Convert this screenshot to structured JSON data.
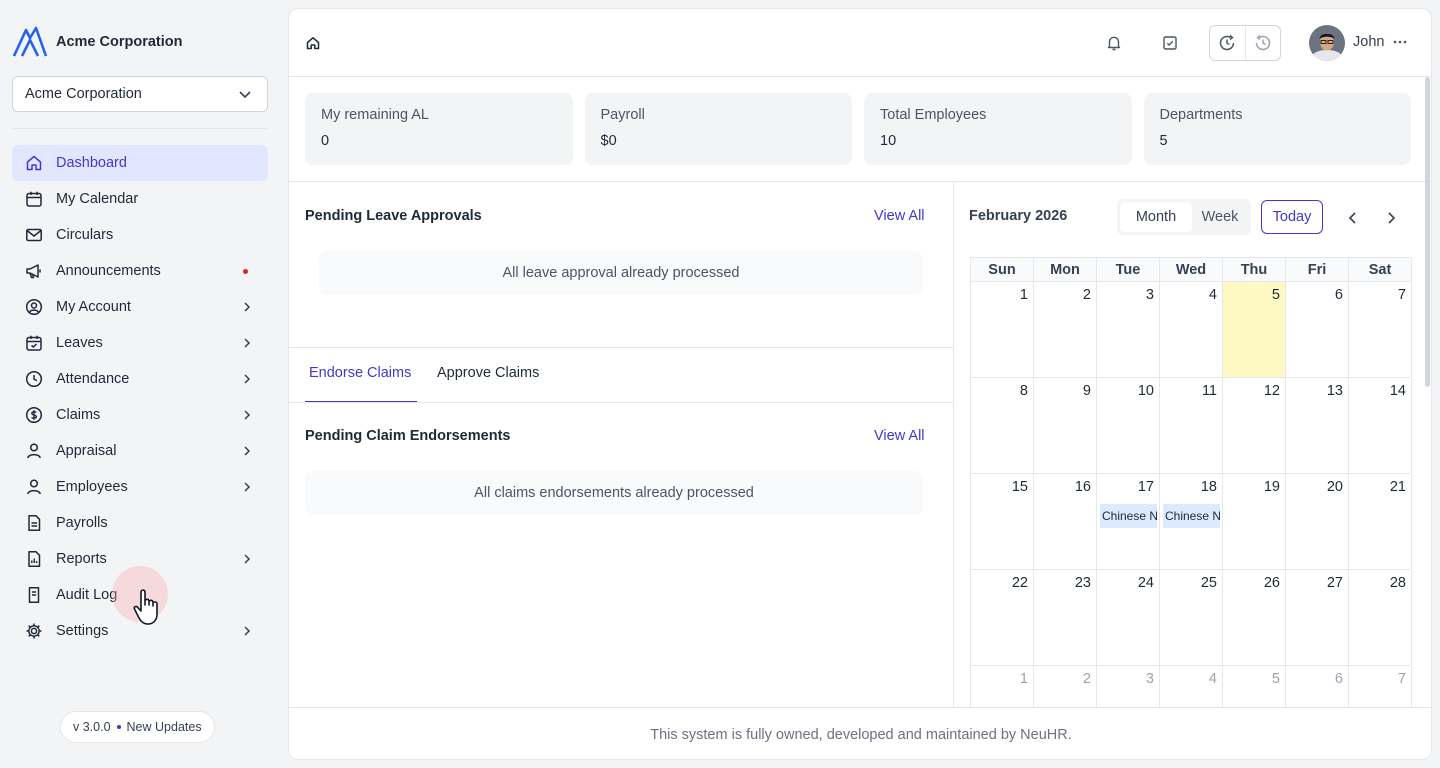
{
  "brand": {
    "name": "Acme Corporation"
  },
  "org_select": {
    "value": "Acme Corporation"
  },
  "sidebar": {
    "items": [
      {
        "label": "Dashboard",
        "icon": "home-icon"
      },
      {
        "label": "My Calendar",
        "icon": "calendar-icon"
      },
      {
        "label": "Circulars",
        "icon": "mail-icon"
      },
      {
        "label": "Announcements",
        "icon": "megaphone-icon"
      },
      {
        "label": "My Account",
        "icon": "user-circle-icon"
      },
      {
        "label": "Leaves",
        "icon": "calendar-check-icon"
      },
      {
        "label": "Attendance",
        "icon": "clock-icon"
      },
      {
        "label": "Claims",
        "icon": "dollar-icon"
      },
      {
        "label": "Appraisal",
        "icon": "user-icon"
      },
      {
        "label": "Employees",
        "icon": "user-icon"
      },
      {
        "label": "Payrolls",
        "icon": "document-icon"
      },
      {
        "label": "Reports",
        "icon": "report-icon"
      },
      {
        "label": "Audit Log",
        "icon": "receipt-icon"
      },
      {
        "label": "Settings",
        "icon": "gear-icon"
      }
    ],
    "version": "v 3.0.0",
    "updates": "New Updates"
  },
  "topbar": {
    "user_name": "John"
  },
  "cards": [
    {
      "label": "My remaining AL",
      "value": "0"
    },
    {
      "label": "Payroll",
      "value": "$0"
    },
    {
      "label": "Total Employees",
      "value": "10"
    },
    {
      "label": "Departments",
      "value": "5"
    }
  ],
  "leave": {
    "title": "Pending Leave Approvals",
    "view_all": "View All",
    "empty": "All leave approval already processed"
  },
  "claims": {
    "tabs": [
      "Endorse Claims",
      "Approve Claims"
    ],
    "title": "Pending Claim Endorsements",
    "view_all": "View All",
    "empty": "All claims endorsements already processed"
  },
  "calendar": {
    "title": "February 2026",
    "views": [
      "Month",
      "Week"
    ],
    "today": "Today",
    "weekdays": [
      "Sun",
      "Mon",
      "Tue",
      "Wed",
      "Thu",
      "Fri",
      "Sat"
    ],
    "weeks": [
      [
        "1",
        "2",
        "3",
        "4",
        "5",
        "6",
        "7"
      ],
      [
        "8",
        "9",
        "10",
        "11",
        "12",
        "13",
        "14"
      ],
      [
        "15",
        "16",
        "17",
        "18",
        "19",
        "20",
        "21"
      ],
      [
        "22",
        "23",
        "24",
        "25",
        "26",
        "27",
        "28"
      ],
      [
        "1",
        "2",
        "3",
        "4",
        "5",
        "6",
        "7"
      ]
    ],
    "events": {
      "17": "Chinese New Year",
      "18": "Chinese New Year"
    },
    "today_date": "5",
    "accent": "#4338ca",
    "today_bg": "#fef9c3",
    "event_bg": "#dbeafe"
  },
  "footer": {
    "text": "This system is fully owned, developed and maintained by NeuHR."
  }
}
